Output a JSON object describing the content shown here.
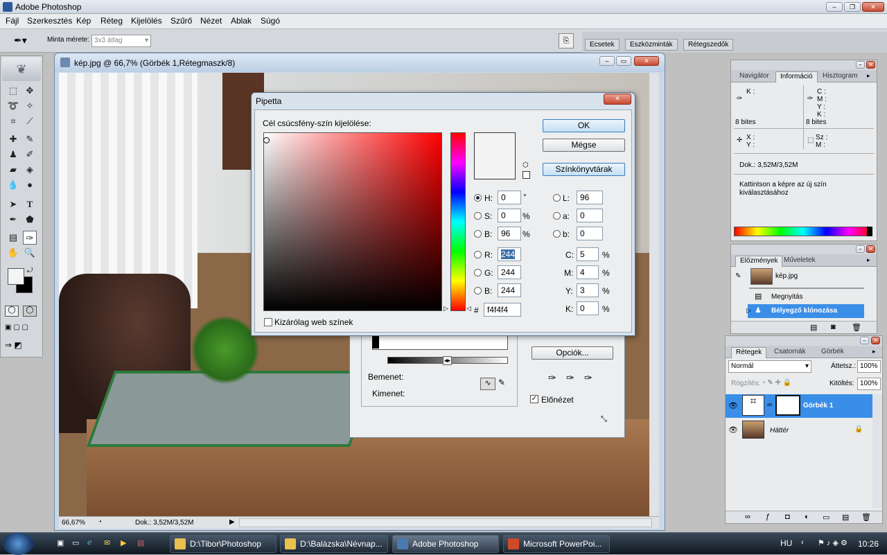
{
  "app": {
    "title": "Adobe Photoshop"
  },
  "menu": [
    "Fájl",
    "Szerkesztés",
    "Kép",
    "Réteg",
    "Kijelölés",
    "Szűrő",
    "Nézet",
    "Ablak",
    "Súgó"
  ],
  "options": {
    "sample_label": "Minta mérete:",
    "sample_value": "3x3 átlag",
    "wells": [
      "Ecsetek",
      "Eszközminták",
      "Rétegszedők"
    ]
  },
  "document": {
    "title": "kép.jpg @ 66,7% (Görbék 1,Rétegmaszk/8)",
    "zoom": "66,67%",
    "doc_size": "Dok.: 3,52M/3,52M"
  },
  "pipetta": {
    "title": "Pipetta",
    "heading": "Cél csúcsfény-szín kijelölése:",
    "ok": "OK",
    "cancel": "Mégse",
    "libraries": "Színkönyvtárak",
    "web_only": "Kizárólag web színek",
    "hsb": [
      {
        "label": "H:",
        "value": "0",
        "unit": "°"
      },
      {
        "label": "S:",
        "value": "0",
        "unit": "%"
      },
      {
        "label": "B:",
        "value": "96",
        "unit": "%"
      }
    ],
    "lab": [
      {
        "label": "L:",
        "value": "96"
      },
      {
        "label": "a:",
        "value": "0"
      },
      {
        "label": "b:",
        "value": "0"
      }
    ],
    "rgb": [
      {
        "label": "R:",
        "value": "244"
      },
      {
        "label": "G:",
        "value": "244"
      },
      {
        "label": "B:",
        "value": "244"
      }
    ],
    "cmyk": [
      {
        "label": "C:",
        "value": "5",
        "unit": "%"
      },
      {
        "label": "M:",
        "value": "4",
        "unit": "%"
      },
      {
        "label": "Y:",
        "value": "3",
        "unit": "%"
      },
      {
        "label": "K:",
        "value": "0",
        "unit": "%"
      }
    ],
    "hash": "#",
    "hex": "f4f4f4",
    "selected_color": "#f4f4f4"
  },
  "curves": {
    "options": "Opciók...",
    "input": "Bemenet:",
    "output": "Kimenet:",
    "preview": "Előnézet"
  },
  "info_panel": {
    "tabs": [
      "Navigátor",
      "Információ",
      "Hisztogram"
    ],
    "k1": "K :",
    "c": "C :",
    "m": "M :",
    "y": "Y :",
    "k2": "K :",
    "bits1": "8 bites",
    "bits2": "8 bites",
    "x": "X :",
    "yy": "Y :",
    "sz": "Sz :",
    "mm": "M :",
    "doc": "Dok.: 3,52M/3,52M",
    "hint": "Kattintson a képre az új szín kiválasztásához"
  },
  "history_panel": {
    "tabs": [
      "Előzmények",
      "Műveletek"
    ],
    "snapshot": "kép.jpg",
    "items": [
      "Megnyitás",
      "Bélyegző klónozása"
    ]
  },
  "layers_panel": {
    "tabs": [
      "Rétegek",
      "Csatornák",
      "Görbék"
    ],
    "blend": "Normál",
    "opacity_label": "Áttetsz.:",
    "opacity": "100%",
    "lock_label": "Rögzítés:",
    "fill_label": "Kitöltés:",
    "fill": "100%",
    "layers": [
      "Görbék 1",
      "Háttér"
    ]
  },
  "taskbar": {
    "tasks": [
      "D:\\Tibor\\Photoshop",
      "D:\\Balázska\\Névnap...",
      "Adobe Photoshop",
      "Microsoft PowerPoi..."
    ],
    "lang": "HU",
    "clock": "10:26"
  }
}
